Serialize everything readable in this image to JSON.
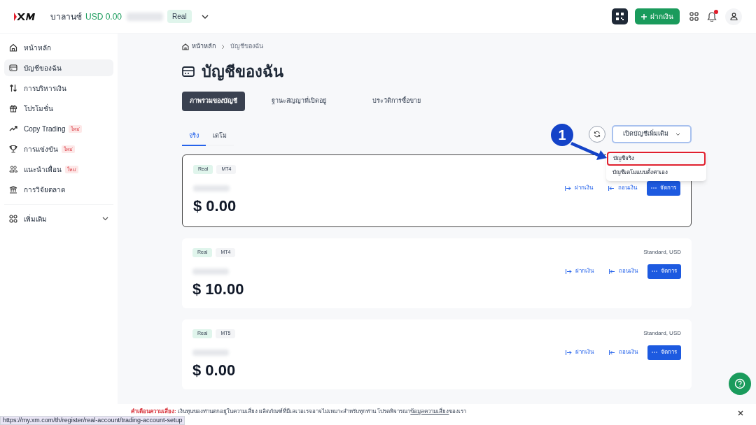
{
  "header": {
    "balance_label": "บาลานซ์",
    "balance_value": "USD 0.00",
    "account_badge": "Real",
    "deposit_button": "ฝากเงิน",
    "notification_dot": true
  },
  "sidebar": {
    "items": [
      {
        "label": "หน้าหลัก",
        "selected": false
      },
      {
        "label": "บัญชีของฉัน",
        "selected": true
      },
      {
        "label": "การบริหารเงิน",
        "selected": false
      },
      {
        "label": "โปรโมชั่น",
        "selected": false
      },
      {
        "label": "Copy Trading",
        "selected": false,
        "badge": "ใหม่"
      },
      {
        "label": "การแข่งขัน",
        "selected": false,
        "badge": "ใหม่"
      },
      {
        "label": "แนะนำเพื่อน",
        "selected": false,
        "badge": "ใหม่"
      },
      {
        "label": "การวิจัยตลาด",
        "selected": false
      }
    ],
    "more": {
      "label": "เพิ่มเติม",
      "expanded": false
    }
  },
  "breadcrumb": [
    "หน้าหลัก",
    "บัญชีของฉัน"
  ],
  "page_title": "บัญชีของฉัน",
  "tabs": [
    {
      "label": "ภาพรวมของบัญชี",
      "selected": true
    },
    {
      "label": "ฐานะสัญญาที่เปิดอยู่",
      "selected": false
    },
    {
      "label": "ประวัติการซื้อขาย",
      "selected": false
    }
  ],
  "subtabs": [
    {
      "label": "จริง",
      "selected": true
    },
    {
      "label": "เดโม",
      "selected": false
    }
  ],
  "open_account_button": "เปิดบัญชีเพิ่มเติม",
  "dropdown": {
    "items": [
      {
        "label": "บัญชีจริง",
        "highlighted": true
      },
      {
        "label": "บัญชีเดโมแบบตั้งค่าเอง",
        "highlighted": false
      }
    ]
  },
  "annotation": {
    "label": "1"
  },
  "accounts": [
    {
      "type_badge": "Real",
      "platform": "MT4",
      "balance": "$ 0.00",
      "selected": true,
      "deposit": "ฝากเงิน",
      "withdraw": "ถอนเงิน",
      "manage": "จัดการ"
    },
    {
      "type_badge": "Real",
      "platform": "MT4",
      "account_type": "Standard, USD",
      "balance": "$ 10.00",
      "selected": false,
      "deposit": "ฝากเงิน",
      "withdraw": "ถอนเงิน",
      "manage": "จัดการ"
    },
    {
      "type_badge": "Real",
      "platform": "MT5",
      "account_type": "Standard, USD",
      "balance": "$ 0.00",
      "selected": false,
      "deposit": "ฝากเงิน",
      "withdraw": "ถอนเงิน",
      "manage": "จัดการ"
    }
  ],
  "risk_warning": {
    "text": "**คำเตือนความเสี่ยง:** เงินทุนของท่านตกอยู่ในความเสี่ยง ผลิตภัณฑ์ที่มีเลเวอเรจอาจไม่เหมาะสำหรับทุกท่าน โปรดพิจารณา",
    "link": "ข้อมูลความเสี่ยง",
    "suffix": "ของเรา"
  },
  "status_url": "https://my.xm.com/th/register/real-account/trading-account-setup"
}
